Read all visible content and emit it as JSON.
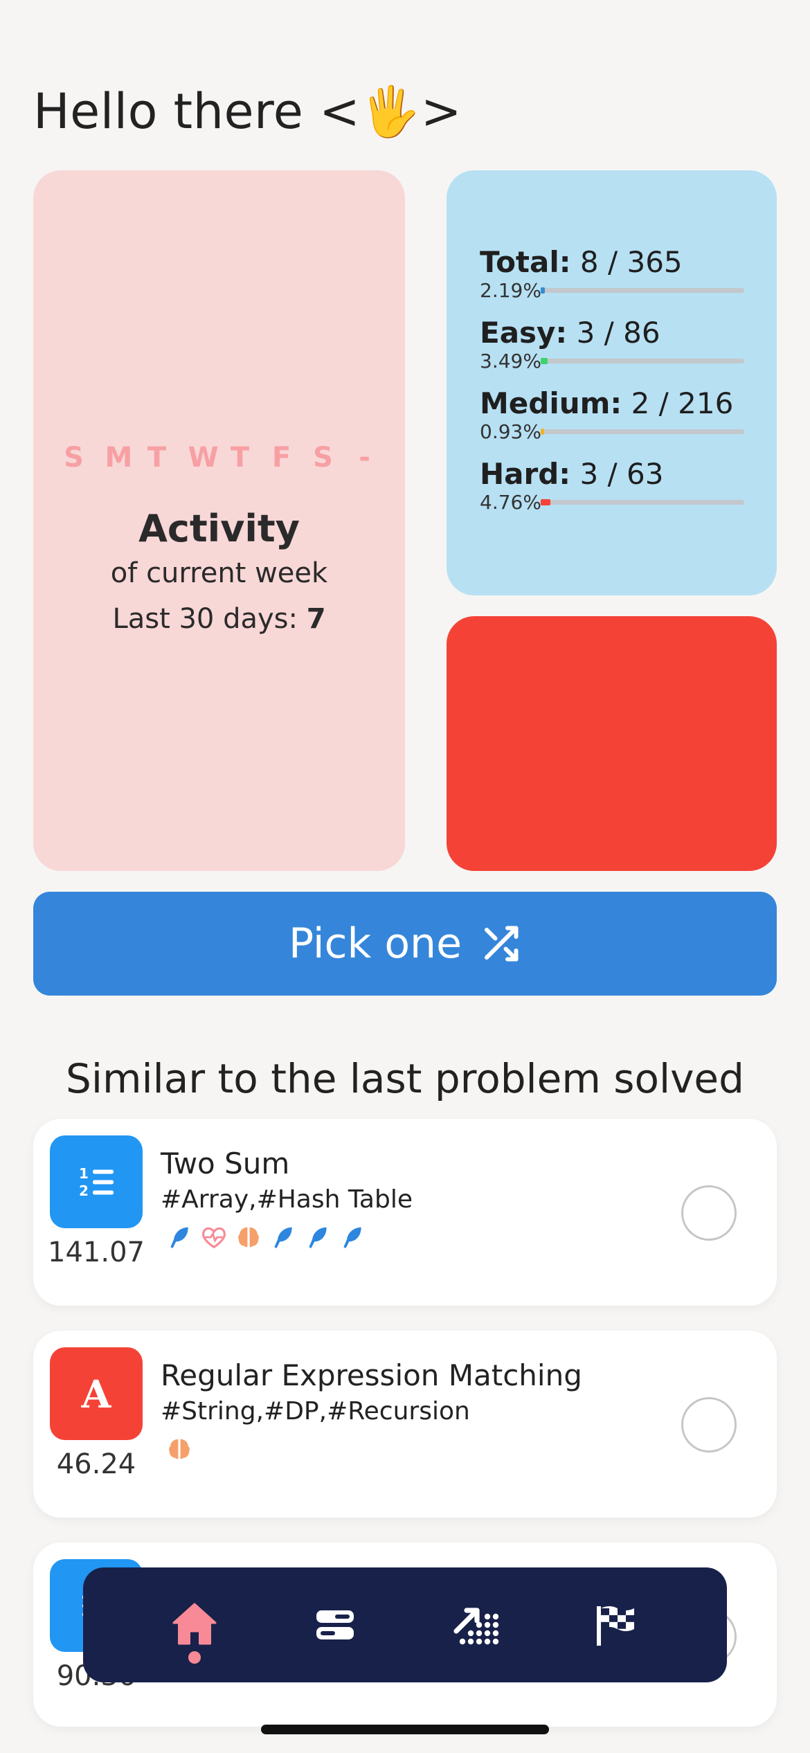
{
  "greeting": "Hello there <🖐>",
  "activity": {
    "days": [
      "S",
      "M",
      "T",
      "W",
      "T",
      "F",
      "S",
      "-"
    ],
    "title": "Activity",
    "subtitle": "of current week",
    "last_label": "Last 30 days: ",
    "last_value": "7"
  },
  "stats": [
    {
      "label": "Total:",
      "value": "8 / 365",
      "percent": "2.19%",
      "fraction": 0.0219,
      "color": "#2f8fd0"
    },
    {
      "label": "Easy:",
      "value": "3 / 86",
      "percent": "3.49%",
      "fraction": 0.0349,
      "color": "#3ed36a"
    },
    {
      "label": "Medium:",
      "value": "2 / 216",
      "percent": "0.93%",
      "fraction": 0.0093,
      "color": "#f0b429"
    },
    {
      "label": "Hard:",
      "value": "3 / 63",
      "percent": "4.76%",
      "fraction": 0.0476,
      "color": "#f44336"
    }
  ],
  "pick_button": {
    "label": "Pick one",
    "icon": "shuffle-icon"
  },
  "section_title": "Similar to the last problem solved",
  "problems": [
    {
      "title": "Two Sum",
      "tags": "#Array,#Hash Table",
      "score": "141.07",
      "icon": "list-numbered-icon",
      "icon_bg": "#2196f3",
      "badges": [
        "feather-icon",
        "heart-pulse-icon",
        "brain-icon",
        "feather-icon",
        "feather-icon",
        "feather-icon"
      ]
    },
    {
      "title": "Regular Expression Matching",
      "tags": "#String,#DP,#Recursion",
      "score": "46.24",
      "icon": "letter-a-icon",
      "icon_bg": "#f44336",
      "badges": [
        "brain-icon"
      ]
    },
    {
      "title": "",
      "tags": "",
      "score": "90.36",
      "icon": "list-icon",
      "icon_bg": "#2196f3",
      "badges": []
    }
  ],
  "nav": [
    "home-icon",
    "stack-icon",
    "chart-trend-icon",
    "finish-flag-icon"
  ]
}
